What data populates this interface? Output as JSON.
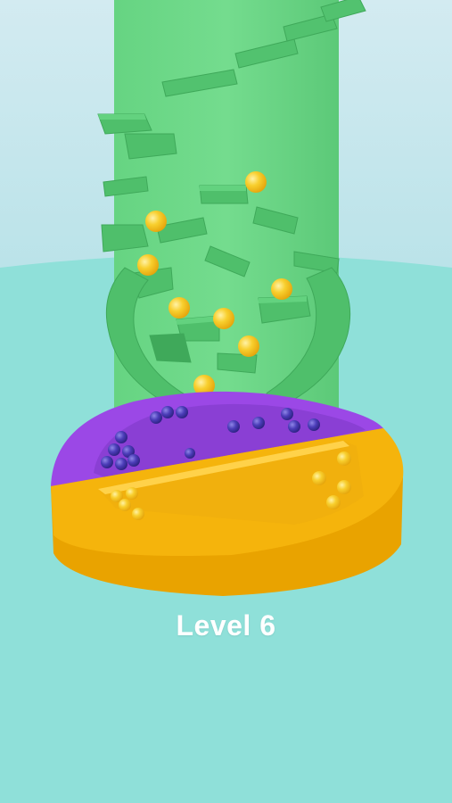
{
  "hud": {
    "level_label": "Level 6"
  },
  "colors": {
    "sky_top": "#cfe9ef",
    "sky_bottom": "#a9dfe3",
    "floor": "#8fe0d9",
    "tower": "#6fd98a",
    "tower_shade": "#52c26f",
    "block": "#4fbf6b",
    "block_top": "#63d27f",
    "block_side": "#3fa95a",
    "purple_bin": "#9b48e6",
    "purple_inner": "#8a3fd4",
    "orange_bin": "#f5b40c",
    "orange_side": "#e9a300",
    "gold_ball": "#f7c928",
    "blue_ball": "#4a3bb5"
  },
  "icons": {
    "gold_ball": "gold-ball-icon",
    "blue_ball": "blue-ball-icon"
  }
}
